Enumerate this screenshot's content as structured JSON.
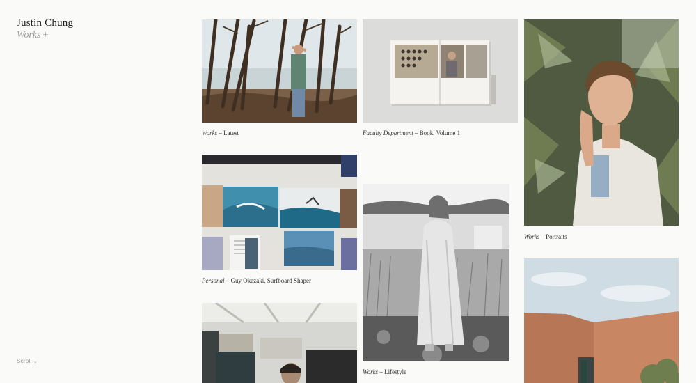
{
  "header": {
    "name": "Justin Chung",
    "section": "Works",
    "plus": "+"
  },
  "scroll_label": "Scroll",
  "projects": [
    {
      "category": "Works",
      "sep": " – ",
      "title": "Latest"
    },
    {
      "category": "Faculty Department",
      "sep": " – ",
      "title": "Book, Volume 1"
    },
    {
      "category": "Works",
      "sep": " – ",
      "title": "Portraits"
    },
    {
      "category": "Personal",
      "sep": " – ",
      "title": "Guy Okazaki, Surfboard Shaper"
    },
    {
      "category": "Works",
      "sep": " – ",
      "title": "Lifestyle"
    }
  ],
  "colors": {
    "background": "#fafaf8",
    "text": "#333333",
    "muted": "#9a9a9a"
  }
}
